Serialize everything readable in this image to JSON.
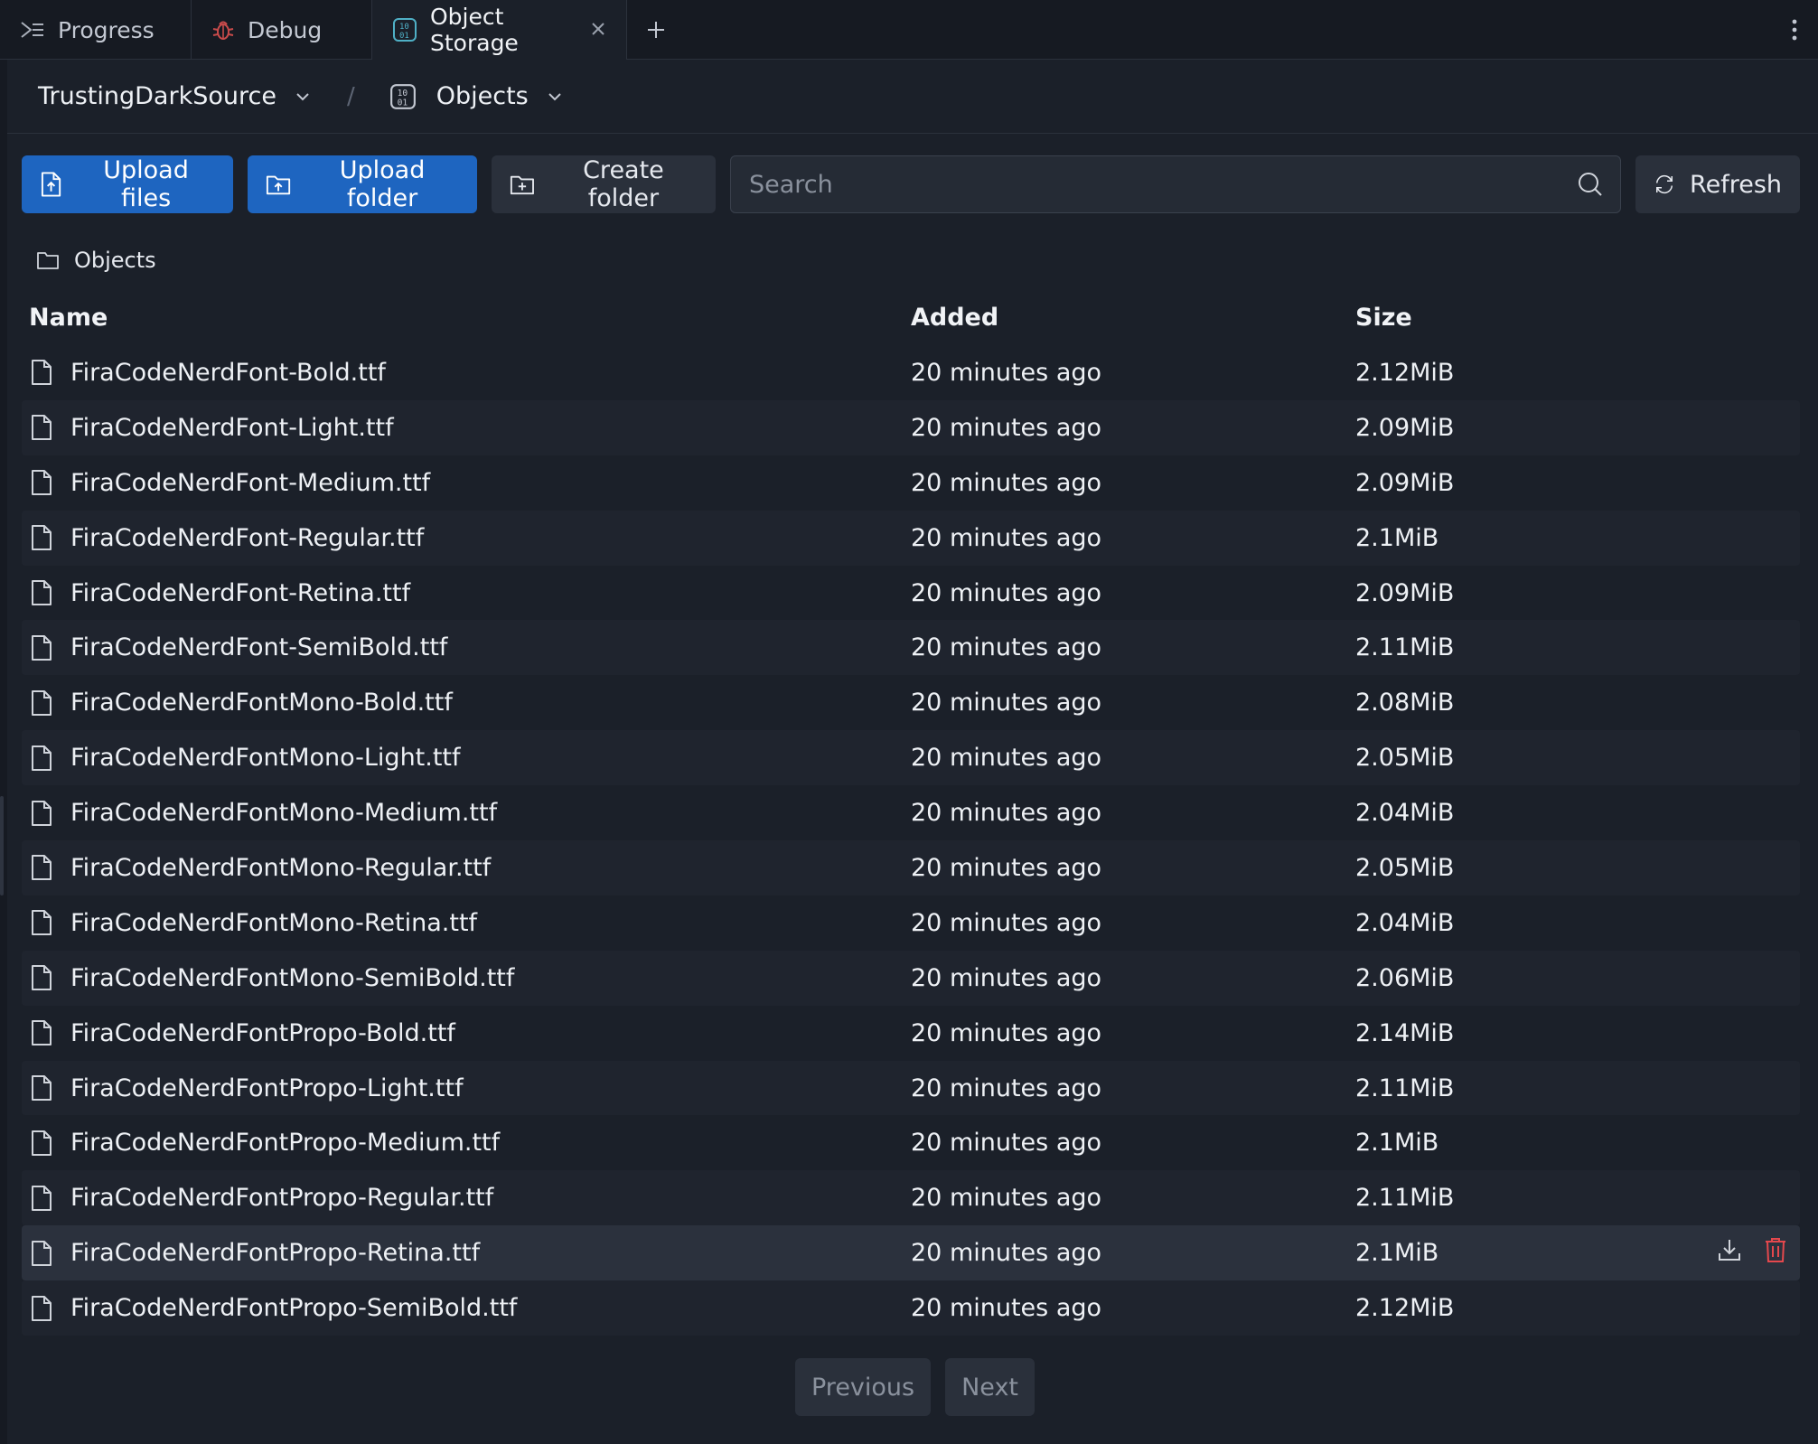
{
  "tabs": [
    {
      "label": "Progress",
      "icon": "terminal-icon"
    },
    {
      "label": "Debug",
      "icon": "bug-icon"
    },
    {
      "label": "Object Storage",
      "icon": "binary-icon",
      "active": true
    }
  ],
  "breadcrumb": {
    "project": "TrustingDarkSource",
    "separator": "/",
    "section": "Objects"
  },
  "toolbar": {
    "upload_files": "Upload files",
    "upload_folder": "Upload folder",
    "create_folder": "Create folder",
    "search_placeholder": "Search",
    "refresh": "Refresh"
  },
  "path": "Objects",
  "table": {
    "columns": [
      "Name",
      "Added",
      "Size"
    ],
    "rows": [
      {
        "name": "FiraCodeNerdFont-Bold.ttf",
        "added": "20 minutes ago",
        "size": "2.12MiB"
      },
      {
        "name": "FiraCodeNerdFont-Light.ttf",
        "added": "20 minutes ago",
        "size": "2.09MiB"
      },
      {
        "name": "FiraCodeNerdFont-Medium.ttf",
        "added": "20 minutes ago",
        "size": "2.09MiB"
      },
      {
        "name": "FiraCodeNerdFont-Regular.ttf",
        "added": "20 minutes ago",
        "size": "2.1MiB"
      },
      {
        "name": "FiraCodeNerdFont-Retina.ttf",
        "added": "20 minutes ago",
        "size": "2.09MiB"
      },
      {
        "name": "FiraCodeNerdFont-SemiBold.ttf",
        "added": "20 minutes ago",
        "size": "2.11MiB"
      },
      {
        "name": "FiraCodeNerdFontMono-Bold.ttf",
        "added": "20 minutes ago",
        "size": "2.08MiB"
      },
      {
        "name": "FiraCodeNerdFontMono-Light.ttf",
        "added": "20 minutes ago",
        "size": "2.05MiB"
      },
      {
        "name": "FiraCodeNerdFontMono-Medium.ttf",
        "added": "20 minutes ago",
        "size": "2.04MiB"
      },
      {
        "name": "FiraCodeNerdFontMono-Regular.ttf",
        "added": "20 minutes ago",
        "size": "2.05MiB"
      },
      {
        "name": "FiraCodeNerdFontMono-Retina.ttf",
        "added": "20 minutes ago",
        "size": "2.04MiB"
      },
      {
        "name": "FiraCodeNerdFontMono-SemiBold.ttf",
        "added": "20 minutes ago",
        "size": "2.06MiB"
      },
      {
        "name": "FiraCodeNerdFontPropo-Bold.ttf",
        "added": "20 minutes ago",
        "size": "2.14MiB"
      },
      {
        "name": "FiraCodeNerdFontPropo-Light.ttf",
        "added": "20 minutes ago",
        "size": "2.11MiB"
      },
      {
        "name": "FiraCodeNerdFontPropo-Medium.ttf",
        "added": "20 minutes ago",
        "size": "2.1MiB"
      },
      {
        "name": "FiraCodeNerdFontPropo-Regular.ttf",
        "added": "20 minutes ago",
        "size": "2.11MiB"
      },
      {
        "name": "FiraCodeNerdFontPropo-Retina.ttf",
        "added": "20 minutes ago",
        "size": "2.1MiB",
        "hovered": true
      },
      {
        "name": "FiraCodeNerdFontPropo-SemiBold.ttf",
        "added": "20 minutes ago",
        "size": "2.12MiB"
      }
    ]
  },
  "pagination": {
    "previous": "Previous",
    "next": "Next"
  },
  "colors": {
    "background": "#1b2029",
    "primary": "#1e65c0",
    "danger": "#e5484d",
    "bug_icon": "#c94b4b",
    "binary_icon": "#4fb0c6"
  }
}
